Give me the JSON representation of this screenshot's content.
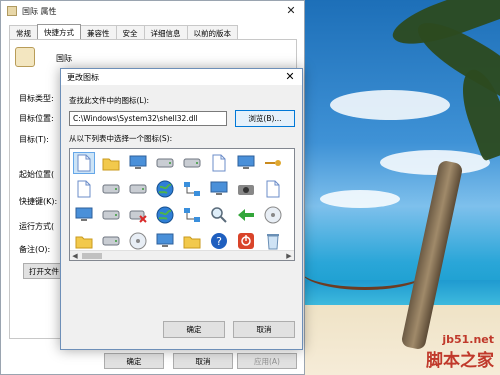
{
  "properties_window": {
    "title": "国际 属性",
    "tabs": [
      "常规",
      "快捷方式",
      "兼容性",
      "安全",
      "详细信息",
      "以前的版本"
    ],
    "active_tab": "快捷方式",
    "app_name": "国际",
    "labels": {
      "target_type": "目标类型:",
      "target_location": "目标位置:",
      "target": "目标(T):",
      "start_in": "起始位置(",
      "shortcut_key": "快捷键(K):",
      "run": "运行方式(",
      "comment": "备注(O):"
    },
    "open_file_location": "打开文件",
    "ok": "确定",
    "cancel": "取消",
    "apply": "应用(A)"
  },
  "change_icon_dialog": {
    "title": "更改图标",
    "search_label": "查找此文件中的图标(L):",
    "path_value": "C:\\Windows\\System32\\shell32.dll",
    "browse": "浏览(B)...",
    "choose_label": "从以下列表中选择一个图标(S):",
    "ok": "确定",
    "cancel": "取消",
    "icons": [
      "blank-document-icon",
      "folder-icon",
      "app-window-icon",
      "memory-chip-icon",
      "hard-drive-icon",
      "document-clock-icon",
      "monitor-window-icon",
      "key-icon",
      "blue-doc-icon",
      "text-document-icon",
      "printer-icon",
      "network-drive-icon",
      "globe-icon",
      "network-computers-icon",
      "control-panel-icon",
      "camera-icon",
      "shortcut-icon",
      "help-file-icon",
      "window-icon",
      "drive-stack-icon",
      "disconnected-drive-icon",
      "world-globe-icon",
      "network-map-icon",
      "magnifier-icon",
      "green-arrow-icon",
      "disc-icon",
      "blue-square-icon",
      "folder-closed-icon",
      "removable-drive-icon",
      "cd-drive-icon",
      "desktop-computer-icon",
      "folder-grid-icon",
      "help-icon",
      "power-icon",
      "recycle-icon",
      "tools-icon"
    ]
  },
  "watermark": {
    "url": "jb51.net",
    "name": "脚本之家"
  }
}
